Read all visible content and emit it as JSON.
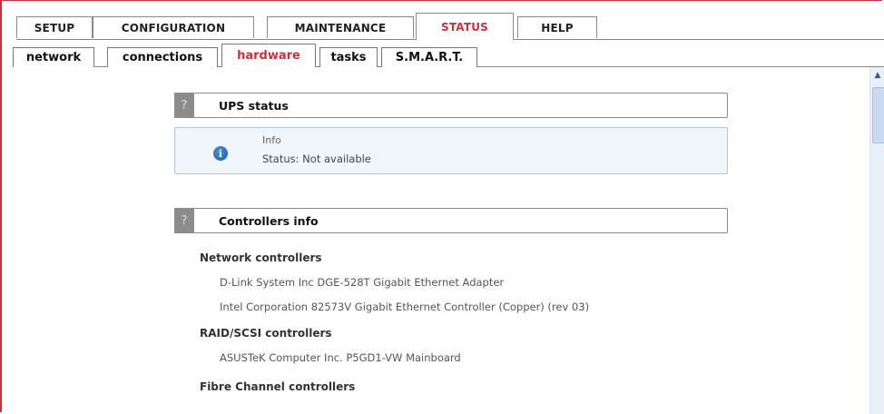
{
  "top_tabs": [
    {
      "label": "SETUP",
      "active": false
    },
    {
      "label": "CONFIGURATION",
      "active": false
    },
    {
      "label": "MAINTENANCE",
      "active": false
    },
    {
      "label": "STATUS",
      "active": true
    },
    {
      "label": "HELP",
      "active": false
    }
  ],
  "sub_tabs": [
    {
      "label": "network",
      "active": false
    },
    {
      "label": "connections",
      "active": false
    },
    {
      "label": "hardware",
      "active": true
    },
    {
      "label": "tasks",
      "active": false
    },
    {
      "label": "S.M.A.R.T.",
      "active": false
    }
  ],
  "ups_section": {
    "help_label": "?",
    "title": "UPS status",
    "info_icon": "info-icon",
    "info_title": "Info",
    "info_status": "Status: Not available"
  },
  "controllers_section": {
    "help_label": "?",
    "title": "Controllers info",
    "groups": [
      {
        "heading": "Network controllers",
        "items": [
          "D-Link System Inc DGE-528T Gigabit Ethernet Adapter",
          "Intel Corporation 82573V Gigabit Ethernet Controller (Copper) (rev 03)"
        ]
      },
      {
        "heading": "RAID/SCSI controllers",
        "items": [
          "ASUSTeK Computer Inc. P5GD1-VW Mainboard"
        ]
      },
      {
        "heading": "Fibre Channel controllers",
        "items": []
      }
    ]
  },
  "colors": {
    "accent": "#c8323c",
    "info_bg": "#f1f6fb",
    "info_border": "#aec8e0",
    "help_box": "#8c8c8c"
  }
}
